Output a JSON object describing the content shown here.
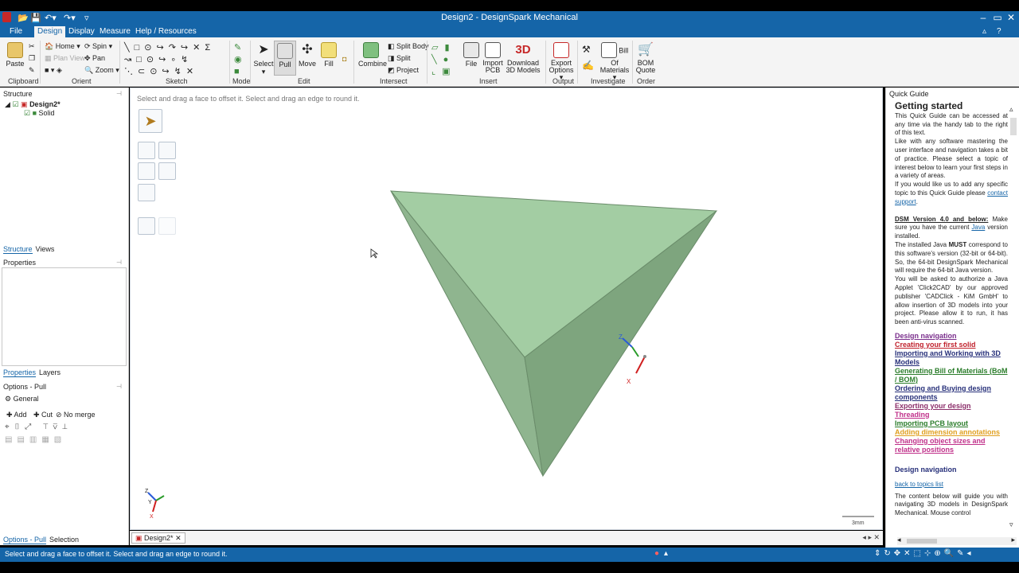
{
  "window": {
    "title": "Design2 - DesignSpark Mechanical",
    "controls": {
      "minimize": "–",
      "restore": "▭",
      "close": "✕"
    }
  },
  "menus": [
    "File",
    "Design",
    "Display",
    "Measure",
    "Help / Resources"
  ],
  "ribbon": {
    "clipboard": {
      "paste": "Paste",
      "label": "Clipboard"
    },
    "orient": {
      "home": "Home",
      "plan_view": "Plan View",
      "spin": "Spin",
      "pan": "Pan",
      "zoom": "Zoom",
      "label": "Orient"
    },
    "sketch": {
      "label": "Sketch"
    },
    "mode": {
      "label": "Mode"
    },
    "edit": {
      "select": "Select",
      "pull": "Pull",
      "move": "Move",
      "fill": "Fill",
      "label": "Edit"
    },
    "intersect": {
      "combine": "Combine",
      "split_body": "Split Body",
      "split": "Split",
      "project": "Project",
      "label": "Intersect"
    },
    "insert": {
      "file": "File",
      "import_pcb": "Import PCB",
      "download_3d": "Download 3D Models",
      "label": "Insert"
    },
    "output": {
      "export_options": "Export Options",
      "label": "Output"
    },
    "investigate": {
      "bom": "Bill Of Materials",
      "label": "Investigate"
    },
    "order": {
      "bom_quote": "BOM Quote",
      "label": "Order"
    }
  },
  "structure": {
    "header": "Structure",
    "tree": {
      "design": "Design2*",
      "solid": "Solid"
    },
    "tabs": [
      "Structure",
      "Views"
    ]
  },
  "properties": {
    "header": "Properties",
    "tabs": [
      "Properties",
      "Layers"
    ]
  },
  "options": {
    "header": "Options - Pull",
    "general": "General",
    "add": "Add",
    "cut": "Cut",
    "no_merge": "No merge",
    "bottom_tabs": [
      "Options - Pull",
      "Selection"
    ]
  },
  "viewport": {
    "hint": "Select and drag a face to offset it. Select and drag an edge to round it.",
    "scale": "3mm",
    "triad": {
      "z": "Z",
      "y": "Y",
      "x": "X"
    },
    "doc_tab": "Design2*"
  },
  "status": {
    "text": "Select and drag a face to offset it. Select and drag an edge to round it."
  },
  "quick_guide": {
    "header": "Quick Guide",
    "title": "Getting started",
    "p1": "This Quick Guide can be accessed at any time via the handy tab to the right of this text.",
    "p2": "Like with any software mastering the user interface and navigation takes a bit of practice. Please select a topic of interest below to learn your first steps in a variety of areas.",
    "p3": "If you would like us to add any specific topic to this Quick Guide please",
    "p3_link": "contact support",
    "dsm_heading": "DSM Version 4.0 and below:",
    "dsm_text1": "Make sure you have the current",
    "java": "Java",
    "dsm_text2": "version installed.",
    "p5a": "The installed Java",
    "must": "MUST",
    "p5b": "correspond to this software's version (32-bit or 64-bit). So, the 64-bit DesignSpark Mechanical will require the 64-bit Java version.",
    "p6": "You will be asked to authorize a Java Applet 'Click2CAD' by our approved publisher 'CADClick - KiM GmbH' to allow insertion of 3D models into your project. Please allow it to run, it has been anti-virus scanned.",
    "topics": [
      {
        "label": "Design navigation",
        "color": "#7a2e8c"
      },
      {
        "label": "Creating your first solid",
        "color": "#c0202b"
      },
      {
        "label": "Importing and Working with 3D Models",
        "color": "#27307a"
      },
      {
        "label": "Generating Bill of Materials (BoM / BOM)",
        "color": "#2b7d2b"
      },
      {
        "label": "Ordering and Buying design components",
        "color": "#27307a"
      },
      {
        "label": "Exporting your design",
        "color": "#8c2e6a"
      },
      {
        "label": "Threading",
        "color": "#c0308a"
      },
      {
        "label": "Importing PCB layout",
        "color": "#2b7d2b"
      },
      {
        "label": "Adding dimension annotations",
        "color": "#e0a020"
      },
      {
        "label": "Changing object sizes and relative positions",
        "color": "#c0308a"
      }
    ],
    "nav_heading": "Design navigation",
    "back": "back to topics list",
    "nav_text": "The content below will guide you with navigating 3D models in DesignSpark Mechanical. Mouse control"
  },
  "colors": {
    "accent": "#1565a8",
    "face_top": "#a3cda3",
    "face_left": "#8fb58f",
    "face_right": "#7ea57e"
  }
}
